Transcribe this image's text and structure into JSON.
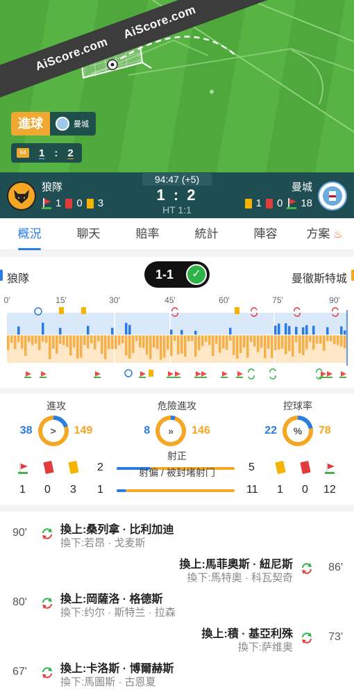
{
  "pitch": {
    "banner_text_1": "AiScore.com",
    "banner_text_2": "AiScore.com",
    "goal_label": "進球",
    "goal_team": "曼城",
    "mini_minute": "94",
    "mini_home_score": "1",
    "mini_sep": ":",
    "mini_away_score": "2"
  },
  "scoreboard": {
    "home_name": "狼隊",
    "away_name": "曼城",
    "home_corners": "1",
    "home_red": "0",
    "home_yellow": "3",
    "away_yellow": "1",
    "away_red": "0",
    "away_corners": "18",
    "time": "94:47 (+5)",
    "score": "1 : 2",
    "half_time": "HT 1:1"
  },
  "tabs": [
    {
      "label": "概況",
      "active": true
    },
    {
      "label": "聊天"
    },
    {
      "label": "賠率"
    },
    {
      "label": "統計"
    },
    {
      "label": "陣容"
    },
    {
      "label": "方案"
    }
  ],
  "timeline": {
    "home_name": "狼隊",
    "away_name": "曼徹斯特城",
    "aggregate": "1-1",
    "minute_labels": [
      "0'",
      "15'",
      "30'",
      "45'",
      "60'",
      "75'",
      "90'"
    ]
  },
  "stats": {
    "attack": {
      "title": "進攻",
      "home": "38",
      "away": "149",
      "icon": ">"
    },
    "dangerous": {
      "title": "危險進攻",
      "home": "8",
      "away": "146",
      "icon": "»"
    },
    "possession": {
      "title": "控球率",
      "home": "22",
      "away": "78",
      "icon": "%"
    },
    "on_target_label": "射正",
    "off_target_label": "射偏 / 被封堵射门",
    "home_on_target": "2",
    "away_on_target": "5",
    "home_off_target": "1",
    "away_off_target": "11",
    "home_corners": "1",
    "home_red": "0",
    "home_yellow": "3",
    "away_yellow": "1",
    "away_red": "0",
    "away_corners": "12"
  },
  "substitutions": [
    {
      "minute": "90'",
      "side": "home",
      "on": "換上:桑列拿 · 比利加迪",
      "off": "換下:若昂 · 戈麦斯"
    },
    {
      "minute": "86'",
      "side": "away",
      "on": "換上:馬菲奧斯 · 紐尼斯",
      "off": "換下:馬特奧 · 科瓦契奇"
    },
    {
      "minute": "80'",
      "side": "home",
      "on": "換上:岡薩洛 · 格德斯",
      "off": "換下:约尔 · 斯特兰 · 拉森"
    },
    {
      "minute": "73'",
      "side": "away",
      "on": "換上:積 · 基亞利殊",
      "off": "換下:萨维奥"
    },
    {
      "minute": "67'",
      "side": "home",
      "on": "換上:卡洛斯 · 博爾赫斯",
      "off": "換下:馬圖斯 · 古恩夏"
    }
  ],
  "colors": {
    "home": "#2a7be4",
    "away": "#f5a623",
    "board": "#1e4d52",
    "goal_badge": "#f0a830"
  }
}
